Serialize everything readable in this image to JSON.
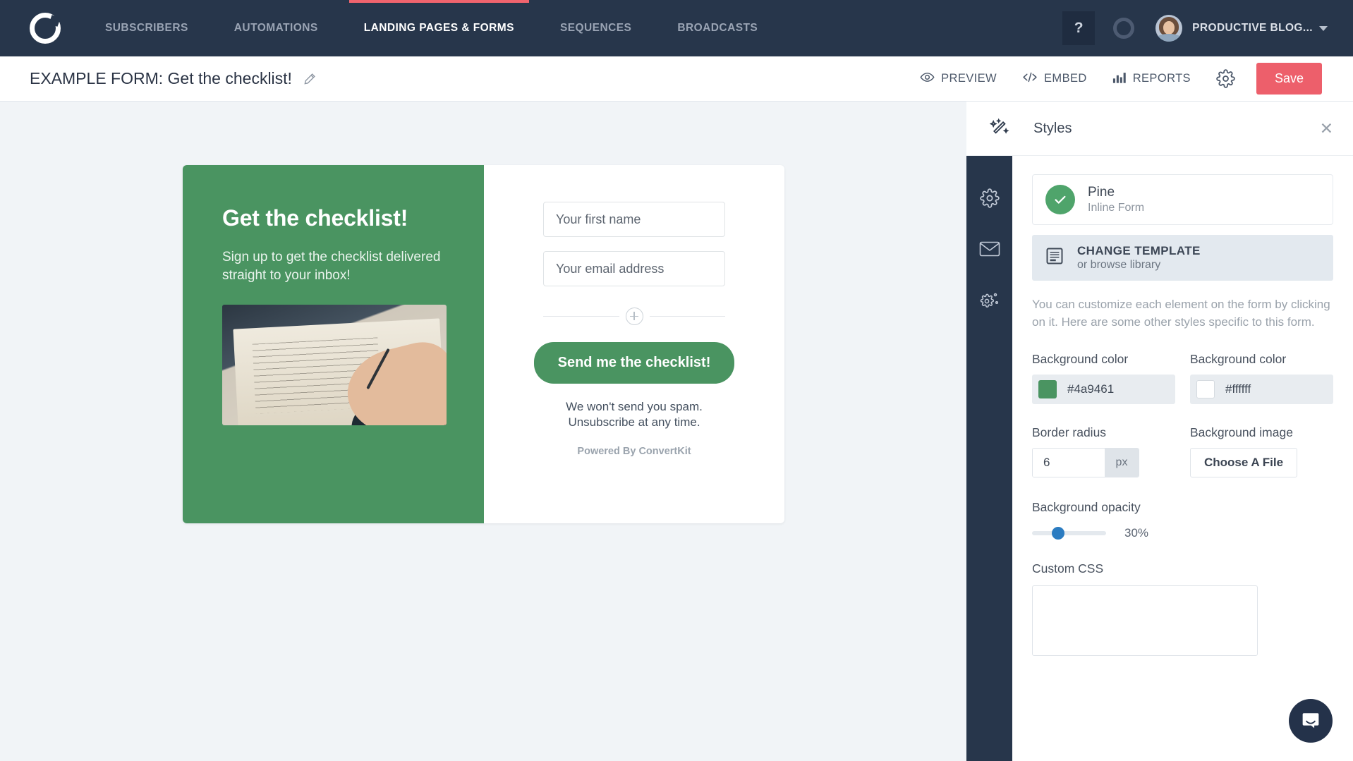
{
  "topnav": {
    "logo_icon": "convertkit-logo-icon",
    "items": [
      {
        "label": "SUBSCRIBERS",
        "active": false
      },
      {
        "label": "AUTOMATIONS",
        "active": false
      },
      {
        "label": "LANDING PAGES & FORMS",
        "active": true
      },
      {
        "label": "SEQUENCES",
        "active": false
      },
      {
        "label": "BROADCASTS",
        "active": false
      }
    ],
    "help_label": "?",
    "status_icon": "ring-icon",
    "account_name": "PRODUCTIVE BLOG...",
    "caret_icon": "chevron-down-icon",
    "active_tab_color": "#f0646e",
    "background": "#27364b"
  },
  "subbar": {
    "title": "EXAMPLE FORM: Get the checklist!",
    "edit_icon": "pencil-icon",
    "actions": [
      {
        "label": "PREVIEW",
        "icon": "eye-icon"
      },
      {
        "label": "EMBED",
        "icon": "code-icon"
      },
      {
        "label": "REPORTS",
        "icon": "bar-chart-icon"
      }
    ],
    "settings_icon": "gear-icon",
    "save_label": "Save",
    "save_color": "#ed5f6b"
  },
  "form_preview": {
    "heading": "Get the checklist!",
    "subheading": "Sign up to get the checklist delivered straight to your inbox!",
    "image_alt": "hand-writing-checklist-photo",
    "fields": [
      {
        "placeholder": "Your first name",
        "name": "first-name"
      },
      {
        "placeholder": "Your email address",
        "name": "email"
      }
    ],
    "add_field_icon": "plus-circle-icon",
    "cta_label": "Send me the checklist!",
    "disclaimer_line1": "We won't send you spam.",
    "disclaimer_line2": "Unsubscribe at any time.",
    "powered_by": "Powered By ConvertKit",
    "left_bg": "#4a9461",
    "right_bg": "#ffffff"
  },
  "panel": {
    "header_icon": "magic-wand-icon",
    "title": "Styles",
    "close_icon": "close-icon",
    "rail_icons": [
      {
        "name": "gear-icon",
        "label": "settings"
      },
      {
        "name": "envelope-icon",
        "label": "incentive-email"
      },
      {
        "name": "gears-icon",
        "label": "advanced-settings"
      }
    ],
    "template": {
      "name": "Pine",
      "type": "Inline Form",
      "selected_icon": "check-circle-icon"
    },
    "change_template": {
      "icon": "template-icon",
      "title": "CHANGE TEMPLATE",
      "subtitle": "or browse library"
    },
    "helper_text": "You can customize each element on the form by clicking on it. Here are some other styles specific to this form.",
    "controls": {
      "bg_color_left_label": "Background color",
      "bg_color_left_value": "#4a9461",
      "bg_color_right_label": "Background color",
      "bg_color_right_value": "#ffffff",
      "border_radius_label": "Border radius",
      "border_radius_value": "6",
      "border_radius_unit": "px",
      "bg_image_label": "Background image",
      "bg_image_button": "Choose A File",
      "opacity_label": "Background opacity",
      "opacity_value": "30%",
      "custom_css_label": "Custom CSS",
      "custom_css_value": ""
    }
  },
  "intercom": {
    "icon": "chat-bubble-icon",
    "color": "#24324a"
  }
}
